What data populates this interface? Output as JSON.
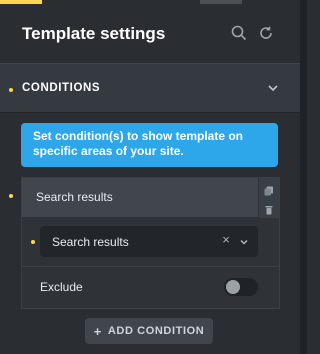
{
  "colors": {
    "accent": "#ffd64f",
    "info_blue": "#2da7ea",
    "panel_bg": "#2a2e33"
  },
  "header": {
    "title": "Template settings",
    "icons": [
      "search-icon",
      "refresh-icon"
    ]
  },
  "conditions": {
    "title": "CONDITIONS",
    "expanded": true,
    "info_text": "Set condition(s) to show template on specific areas of your site.",
    "groups": [
      {
        "label": "Search results",
        "actions": [
          "copy-icon",
          "trash-icon"
        ],
        "rule": {
          "value": "Search results",
          "clear_icon": "×",
          "dropdown_icon": "chevron-down-icon"
        },
        "exclude": {
          "label": "Exclude",
          "on": false
        }
      }
    ],
    "add_button": {
      "icon": "+",
      "label": "ADD CONDITION"
    }
  }
}
